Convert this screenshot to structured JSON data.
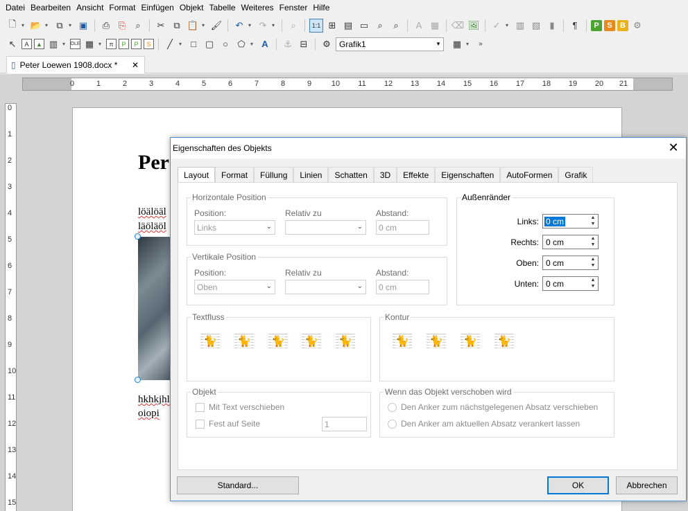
{
  "menu": [
    "Datei",
    "Bearbeiten",
    "Ansicht",
    "Format",
    "Einfügen",
    "Objekt",
    "Tabelle",
    "Weiteres",
    "Fenster",
    "Hilfe"
  ],
  "toolbar2": {
    "name_box_value": "Grafik1"
  },
  "document_tab": {
    "title": "Peter Loewen 1908.docx *",
    "close": "✕"
  },
  "ruler": {
    "h_ticks": [
      "0",
      "1",
      "2",
      "3",
      "4",
      "5",
      "6",
      "7",
      "8",
      "9",
      "10",
      "11",
      "12",
      "13",
      "14",
      "15",
      "16",
      "17",
      "18",
      "19",
      "20",
      "21"
    ],
    "v_ticks": [
      "0",
      "1",
      "2",
      "3",
      "4",
      "5",
      "6",
      "7",
      "8",
      "9",
      "10",
      "11",
      "12",
      "13",
      "14",
      "15"
    ]
  },
  "document": {
    "heading": "Per",
    "line1": "löälöäl",
    "line2": "läöläöl",
    "line3": "hkhkjhl",
    "line4": "oiopi"
  },
  "dialog": {
    "title": "Eigenschaften des Objekts",
    "close": "✕",
    "tabs": [
      "Layout",
      "Format",
      "Füllung",
      "Linien",
      "Schatten",
      "3D",
      "Effekte",
      "Eigenschaften",
      "AutoFormen",
      "Grafik"
    ],
    "horizontal": {
      "legend": "Horizontale Position",
      "position_label": "Position:",
      "position_value": "Links",
      "relative_label": "Relativ zu",
      "relative_value": "",
      "distance_label": "Abstand:",
      "distance_value": "0 cm"
    },
    "vertical": {
      "legend": "Vertikale Position",
      "position_label": "Position:",
      "position_value": "Oben",
      "relative_label": "Relativ zu",
      "relative_value": "",
      "distance_label": "Abstand:",
      "distance_value": "0 cm"
    },
    "margins": {
      "legend": "Außenränder",
      "left_label": "Links:",
      "left_value": "0 cm",
      "right_label": "Rechts:",
      "right_value": "0 cm",
      "top_label": "Oben:",
      "top_value": "0 cm",
      "bottom_label": "Unten:",
      "bottom_value": "0 cm"
    },
    "textflow": {
      "legend": "Textfluss"
    },
    "contour": {
      "legend": "Kontur"
    },
    "object": {
      "legend": "Objekt",
      "move_with_text": "Mit Text verschieben",
      "fixed_on_page": "Fest auf Seite",
      "page_value": "1"
    },
    "anchor_move": {
      "legend": "Wenn das Objekt verschoben wird",
      "option1": "Den Anker zum nächstgelegenen Absatz verschieben",
      "option2": "Den Anker am aktuellen Absatz verankert lassen"
    },
    "buttons": {
      "standard": "Standard...",
      "ok": "OK",
      "cancel": "Abbrechen"
    }
  },
  "colors": {
    "accent": "#0078d7",
    "dialog_border": "#4a8bd6"
  }
}
